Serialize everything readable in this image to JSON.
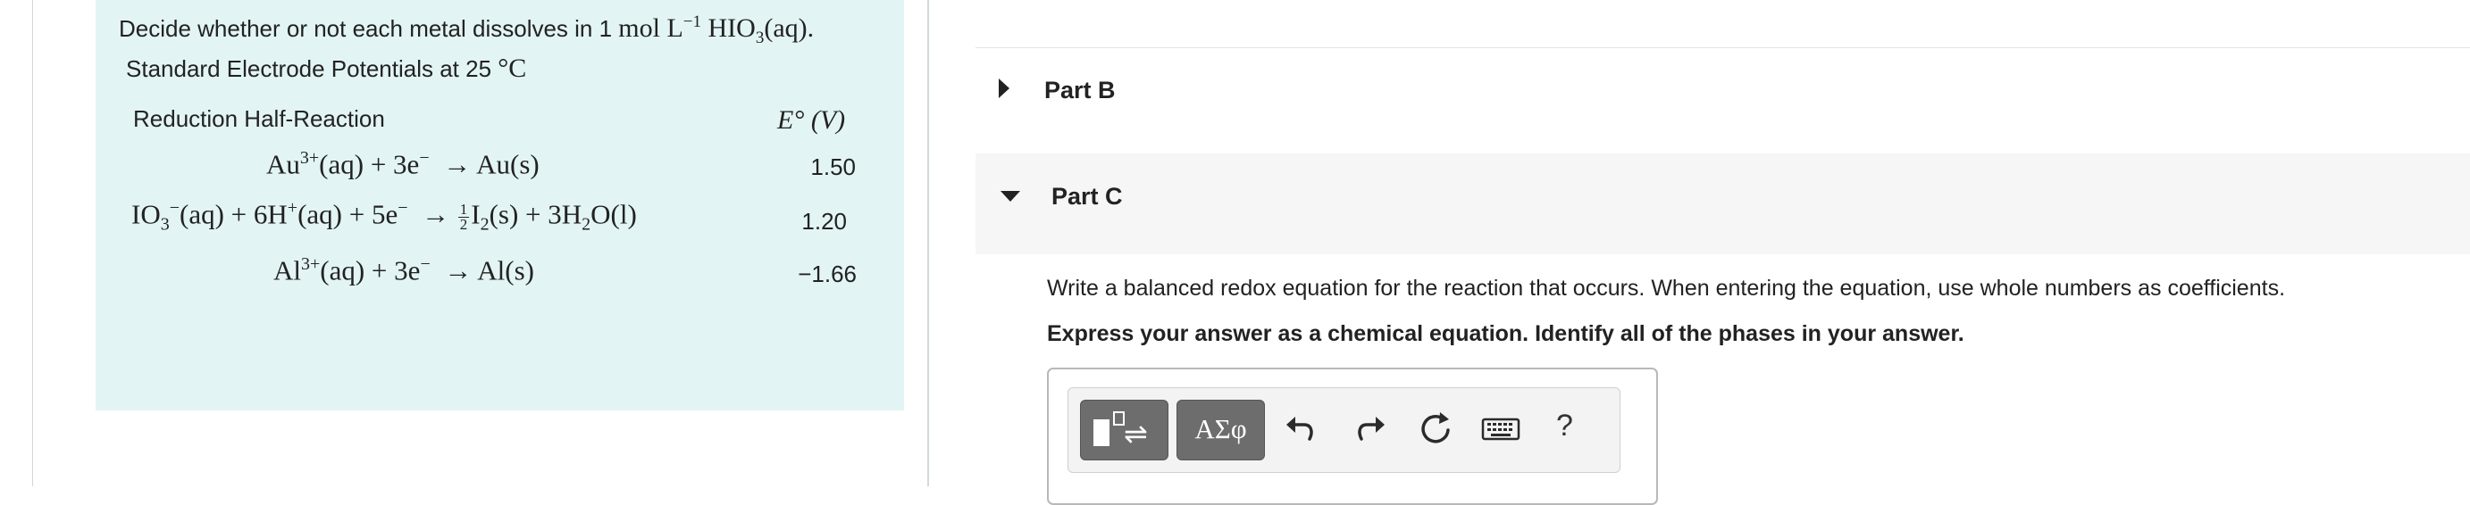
{
  "question": {
    "prefix": "Decide whether or not each metal dissolves in 1 ",
    "unit": "mol L",
    "unit_exp": "−1",
    "solution_pre": " HIO",
    "solution_sub": "3",
    "solution_post": "(aq)."
  },
  "table": {
    "title": "Standard Electrode Potentials at 25 ",
    "title_unit": "°C",
    "col_reaction": "Reduction Half-Reaction",
    "col_potential": "E° (V)",
    "rows": [
      {
        "reaction": "Au³⁺(aq) + 3e⁻ → Au(s)",
        "potential": "1.50"
      },
      {
        "reaction": "IO₃⁻(aq) + 6H⁺(aq) + 5e⁻ → ½I₂(s) + 3H₂O(l)",
        "potential": "1.20"
      },
      {
        "reaction": "Al³⁺(aq) + 3e⁻ → Al(s)",
        "potential": "−1.66"
      }
    ]
  },
  "parts": {
    "part_b": {
      "label": "Part B",
      "state": "collapsed",
      "icon": "triangle-right-icon"
    },
    "part_c": {
      "label": "Part C",
      "state": "expanded",
      "icon": "triangle-down-icon",
      "instruction": "Write a balanced redox equation for the reaction that occurs. When entering the equation, use whole numbers as coefficients.",
      "instruction_bold": "Express your answer as a chemical equation. Identify all of the phases in your answer."
    }
  },
  "toolbar": {
    "symbols_label": "ΑΣφ",
    "help_label": "?",
    "buttons": [
      "templates-icon",
      "symbols",
      "undo-icon",
      "redo-icon",
      "reset-icon",
      "keyboard-icon",
      "help"
    ]
  },
  "colors": {
    "panel_bg": "#e3f4f4",
    "part_c_bg": "#f6f6f6",
    "toolbar_button": "#6d6d6d"
  }
}
